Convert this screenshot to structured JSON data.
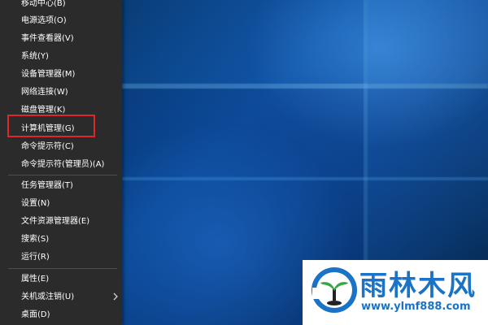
{
  "menu": {
    "items": [
      {
        "label": "移动中心(B)"
      },
      {
        "label": "电源选项(O)"
      },
      {
        "label": "事件查看器(V)"
      },
      {
        "label": "系统(Y)"
      },
      {
        "label": "设备管理器(M)"
      },
      {
        "label": "网络连接(W)"
      },
      {
        "label": "磁盘管理(K)"
      },
      {
        "label": "计算机管理(G)"
      },
      {
        "label": "命令提示符(C)"
      },
      {
        "label": "命令提示符(管理员)(A)"
      },
      {
        "label": "任务管理器(T)"
      },
      {
        "label": "设置(N)"
      },
      {
        "label": "文件资源管理器(E)"
      },
      {
        "label": "搜索(S)"
      },
      {
        "label": "运行(R)"
      },
      {
        "label": "属性(E)"
      },
      {
        "label": "关机或注销(U)"
      },
      {
        "label": "桌面(D)"
      }
    ],
    "highlighted_item": "计算机管理(G)",
    "highlight_color": "#e0262b",
    "background_color": "#2b2b2b"
  },
  "watermark": {
    "title": "雨林木风",
    "url": "www.ylmf888.com",
    "brand_color": "#1a73c6"
  }
}
